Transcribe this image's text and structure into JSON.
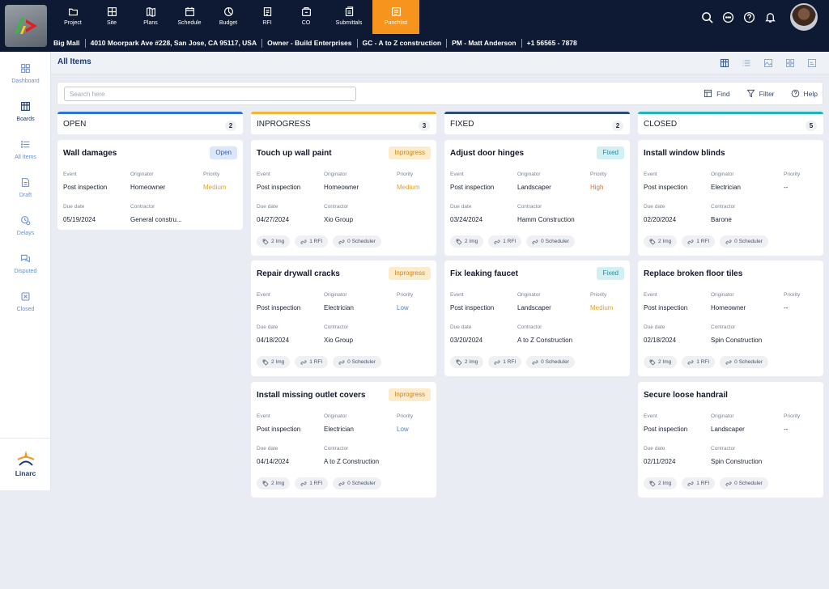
{
  "nav": [
    {
      "label": "Project",
      "icon": "folder-icon"
    },
    {
      "label": "Site",
      "icon": "site-icon"
    },
    {
      "label": "Plans",
      "icon": "map-icon"
    },
    {
      "label": "Schedule",
      "icon": "calendar-icon"
    },
    {
      "label": "Budget",
      "icon": "budget-icon"
    },
    {
      "label": "RFI",
      "icon": "rfi-icon"
    },
    {
      "label": "CO",
      "icon": "co-icon"
    },
    {
      "label": "Submittals",
      "icon": "submittals-icon"
    },
    {
      "label": "Punchlist",
      "icon": "punchlist-icon"
    }
  ],
  "infobar": {
    "project": "Big Mall",
    "address": "4010 Moorpark Ave #228, San Jose, CA 95117, USA",
    "owner": "Owner - Build Enterprises",
    "gc": "GC - A to Z construction",
    "pm": "PM - Matt Anderson",
    "phone": "+1 56565 - 7878"
  },
  "sidebar": [
    {
      "label": "Dashboard"
    },
    {
      "label": "Boards"
    },
    {
      "label": "All Items"
    },
    {
      "label": "Draft"
    },
    {
      "label": "Delays"
    },
    {
      "label": "Disputed"
    },
    {
      "label": "Closed"
    }
  ],
  "brand": "Linarc",
  "page": {
    "title": "All Items"
  },
  "search": {
    "placeholder": "Search here"
  },
  "tools": {
    "find": "Find",
    "filter": "Filter",
    "help": "Help"
  },
  "labels": {
    "event": "Event",
    "originator": "Originator",
    "priority": "Priority",
    "due": "Due date",
    "contractor": "Contractor"
  },
  "colors": {
    "open": "#2f74d0",
    "inprogress": "#f2b53a",
    "fixed": "#2b4c6f",
    "closed": "#27b3b6",
    "accent": "#f7941d",
    "navy": "#0e1a33"
  },
  "columns": [
    {
      "title": "OPEN",
      "count": "2",
      "cards": [
        {
          "title": "Wall damages",
          "status": "Open",
          "event": "Post inspection",
          "originator": "Homeowner",
          "priority": "Medium",
          "due": "05/19/2024",
          "contractor": "General constru..."
        }
      ]
    },
    {
      "title": "INPROGRESS",
      "count": "3",
      "cards": [
        {
          "title": "Touch up wall paint",
          "status": "Inprogress",
          "event": "Post inspection",
          "originator": "Homeowner",
          "priority": "Medium",
          "due": "04/27/2024",
          "contractor": "Xio Group",
          "chips": [
            "2 Img",
            "1 RFI",
            "0 Scheduler"
          ]
        },
        {
          "title": "Repair drywall cracks",
          "status": "Inprogress",
          "event": "Post inspection",
          "originator": "Electrician",
          "priority": "Low",
          "due": "04/18/2024",
          "contractor": "Xio Group",
          "chips": [
            "2 Img",
            "1 RFI",
            "0 Scheduler"
          ]
        },
        {
          "title": "Install missing outlet covers",
          "status": "Inprogress",
          "event": "Post inspection",
          "originator": "Electrician",
          "priority": "Low",
          "due": "04/14/2024",
          "contractor": "A to Z Construction",
          "chips": [
            "2 Img",
            "1 RFI",
            "0 Scheduler"
          ]
        }
      ]
    },
    {
      "title": "FIXED",
      "count": "2",
      "cards": [
        {
          "title": "Adjust door hinges",
          "status": "Fixed",
          "event": "Post inspection",
          "originator": "Landscaper",
          "priority": "High",
          "due": "03/24/2024",
          "contractor": "Hamm Construction",
          "chips": [
            "2 Img",
            "1 RFI",
            "0 Scheduler"
          ]
        },
        {
          "title": "Fix leaking faucet",
          "status": "Fixed",
          "event": "Post inspection",
          "originator": "Landscaper",
          "priority": "Medium",
          "due": "03/20/2024",
          "contractor": "A to Z Construction",
          "chips": [
            "2 Img",
            "1 RFI",
            "0 Scheduler"
          ]
        }
      ]
    },
    {
      "title": "CLOSED",
      "count": "5",
      "cards": [
        {
          "title": "Install window blinds",
          "event": "Post inspection",
          "originator": "Electrician",
          "priority": "--",
          "due": "02/20/2024",
          "contractor": "Barone",
          "chips": [
            "2 Img",
            "1 RFI",
            "0 Scheduler"
          ]
        },
        {
          "title": "Replace broken floor tiles",
          "event": "Post inspection",
          "originator": "Homeowner",
          "priority": "--",
          "due": "02/18/2024",
          "contractor": "Spin Construction",
          "chips": [
            "2 Img",
            "1 RFI",
            "0 Scheduler"
          ]
        },
        {
          "title": "Secure loose handrail",
          "event": "Post inspection",
          "originator": "Landscaper",
          "priority": "--",
          "due": "02/11/2024",
          "contractor": "Spin Construction",
          "chips": [
            "2 Img",
            "1 RFI",
            "0 Scheduler"
          ]
        }
      ]
    }
  ]
}
